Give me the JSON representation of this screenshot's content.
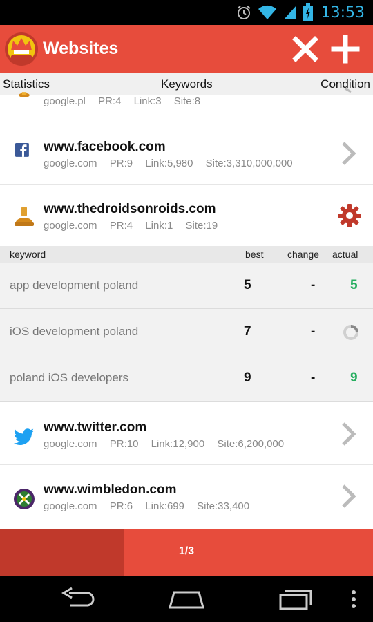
{
  "status_bar": {
    "time": "13:53",
    "icons": [
      "alarm-icon",
      "wifi-icon",
      "signal-icon",
      "battery-icon"
    ]
  },
  "action_bar": {
    "title": "Websites",
    "logo_text": "SEO PRO",
    "actions": [
      "close-icon",
      "add-icon"
    ]
  },
  "tabs": [
    {
      "label": "Statistics"
    },
    {
      "label": "Keywords"
    },
    {
      "label": "Condition"
    }
  ],
  "sites_top": [
    {
      "name": "",
      "engine": "google.pl",
      "pr": "PR:4",
      "links": "Link:3",
      "site": "Site:8",
      "icon": "trophy-icon"
    },
    {
      "name": "www.facebook.com",
      "engine": "google.com",
      "pr": "PR:9",
      "links": "Link:5,980",
      "site": "Site:3,310,000,000",
      "icon": "facebook-icon"
    },
    {
      "name": "www.thedroidsonroids.com",
      "engine": "google.com",
      "pr": "PR:4",
      "links": "Link:1",
      "site": "Site:19",
      "icon": "trophy-icon"
    }
  ],
  "keyword_table": {
    "headers": {
      "keyword": "keyword",
      "best": "best",
      "change": "change",
      "actual": "actual"
    },
    "rows": [
      {
        "keyword": "app development poland",
        "best": "5",
        "change": "-",
        "actual": "5"
      },
      {
        "keyword": "iOS development poland",
        "best": "7",
        "change": "-",
        "actual": ""
      },
      {
        "keyword": "poland  iOS developers",
        "best": "9",
        "change": "-",
        "actual": "9"
      }
    ]
  },
  "sites_bottom": [
    {
      "name": "www.twitter.com",
      "engine": "google.com",
      "pr": "PR:10",
      "links": "Link:12,900",
      "site": "Site:6,200,000",
      "icon": "twitter-icon"
    },
    {
      "name": "www.wimbledon.com",
      "engine": "google.com",
      "pr": "PR:6",
      "links": "Link:699",
      "site": "Site:33,400",
      "icon": "wimbledon-icon"
    }
  ],
  "pager": {
    "label": "1/3",
    "progress": 0.333
  },
  "colors": {
    "brand_red": "#e74c3c",
    "brand_dark_red": "#c0392b",
    "positive_green": "#27ae60",
    "clock_blue": "#33b5e5"
  }
}
